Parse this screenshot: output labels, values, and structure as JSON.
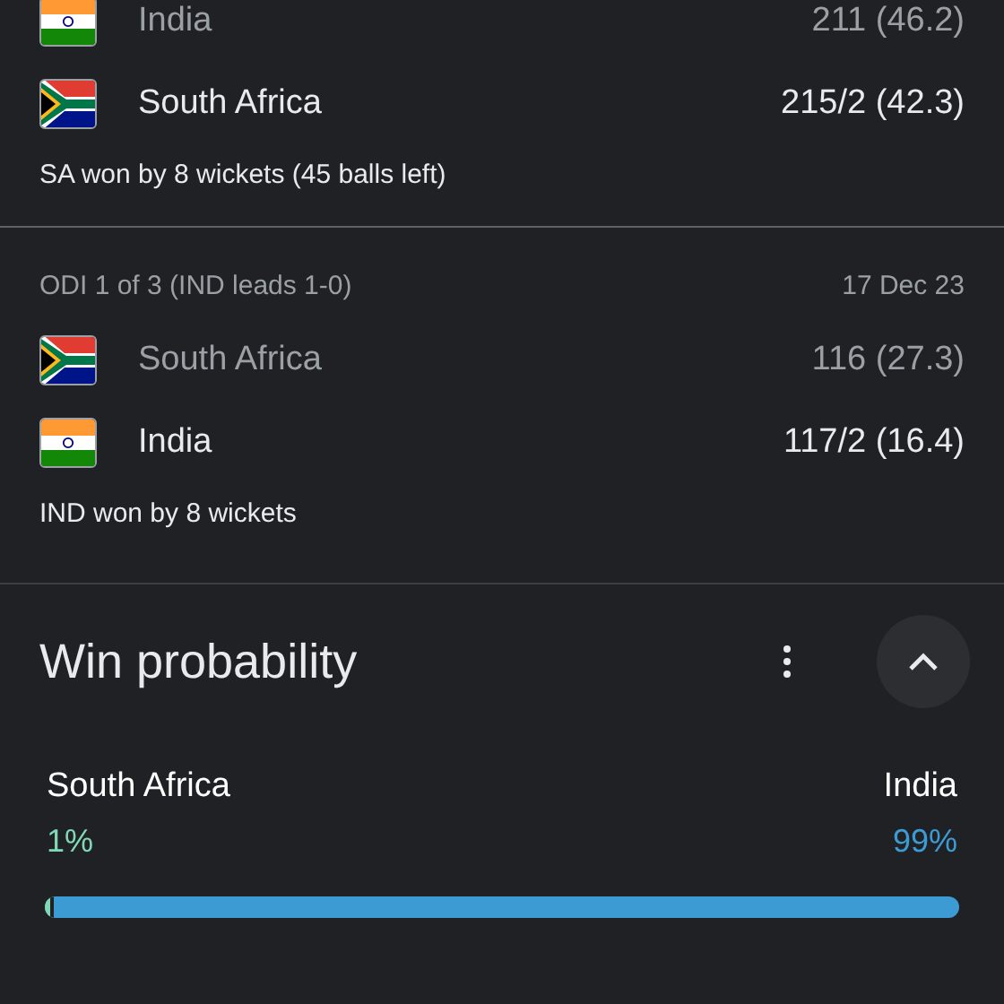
{
  "matches": [
    {
      "teams": [
        {
          "name": "India",
          "kind": "in",
          "score": "211 (46.2)",
          "winner": false
        },
        {
          "name": "South Africa",
          "kind": "za",
          "score": "215/2 (42.3)",
          "winner": true
        }
      ],
      "result": "SA won by 8 wickets (45 balls left)"
    },
    {
      "header": "ODI 1 of 3 (IND leads 1-0)",
      "date": "17 Dec 23",
      "teams": [
        {
          "name": "South Africa",
          "kind": "za",
          "score": "116 (27.3)",
          "winner": false
        },
        {
          "name": "India",
          "kind": "in",
          "score": "117/2 (16.4)",
          "winner": true
        }
      ],
      "result": "IND won by 8 wickets"
    }
  ],
  "win_probability": {
    "title": "Win probability",
    "expanded": true,
    "teams": [
      {
        "name": "South Africa",
        "percent": "1%",
        "level": 0.01,
        "color": "#81d8b4"
      },
      {
        "name": "India",
        "percent": "99%",
        "color": "#3d9bd4"
      }
    ]
  }
}
